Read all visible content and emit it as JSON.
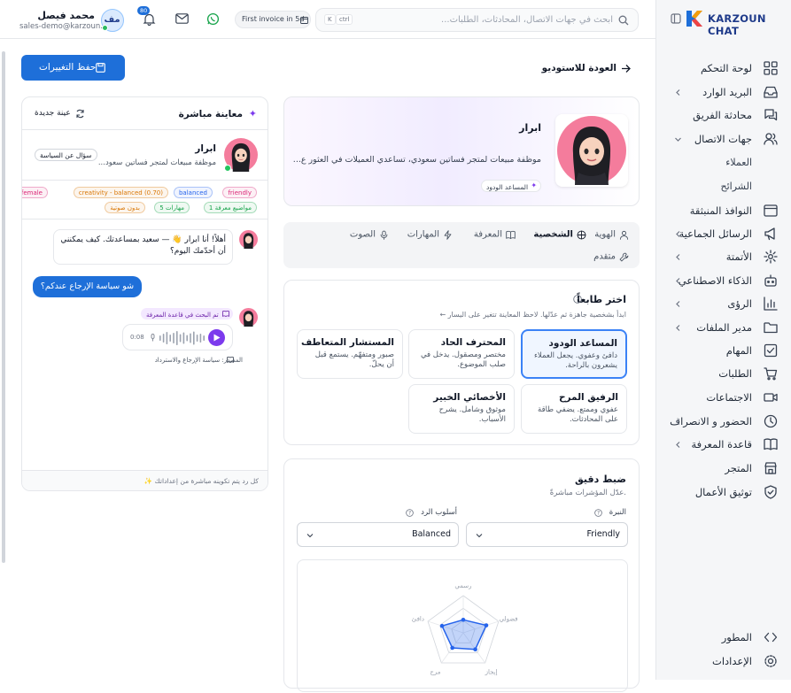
{
  "sidebar": {
    "brand": "KARZOUN CHAT",
    "items": [
      {
        "label": "لوحة التحكم",
        "icon": "dashboard-icon"
      },
      {
        "label": "البريد الوارد",
        "icon": "inbox-icon"
      },
      {
        "label": "محادثة الفريق",
        "icon": "team-chat-icon"
      },
      {
        "label": "جهات الاتصال",
        "icon": "contacts-icon"
      },
      {
        "label": "العملاء",
        "icon": ""
      },
      {
        "label": "الشرائح",
        "icon": ""
      },
      {
        "label": "النوافذ المنبثقة",
        "icon": "popup-icon"
      },
      {
        "label": "الرسائل الجماعية",
        "icon": "megaphone-icon"
      },
      {
        "label": "الأتمتة",
        "icon": "automation-icon"
      },
      {
        "label": "الذكاء الاصطناعي",
        "icon": "ai-bot-icon"
      },
      {
        "label": "الرؤى",
        "icon": "insights-icon"
      },
      {
        "label": "مدير الملفات",
        "icon": "folder-icon"
      },
      {
        "label": "المهام",
        "icon": "tasks-icon"
      },
      {
        "label": "الطلبات",
        "icon": "cart-icon"
      },
      {
        "label": "الاجتماعات",
        "icon": "video-icon"
      },
      {
        "label": "الحضور و الانصراف",
        "icon": "clock-icon"
      },
      {
        "label": "قاعدة المعرفة",
        "icon": "book-icon"
      },
      {
        "label": "المتجر",
        "icon": "store-icon"
      },
      {
        "label": "توثيق الأعمال",
        "icon": "shield-check-icon"
      }
    ],
    "developer": "المطور",
    "settings": "الإعدادات"
  },
  "topbar": {
    "search_placeholder": "ابحث في جهات الاتصال، المحادثات، الطلبات...",
    "shortcut_k": "K",
    "shortcut_ctrl": "ctrl",
    "invoice": "First invoice in 5d",
    "notifications_count": "80",
    "user_name": "محمد فيصل",
    "user_email": "sales-demo@karzoun...",
    "user_initials": "مف"
  },
  "main": {
    "back_label": "العودة للاستوديو",
    "save_label": "حفظ التغييرات",
    "agent": {
      "name": "ابرار",
      "description": "موظفة مبيعات لمتجر فساتين سعودي، تساعدي العميلات في العثور ع...",
      "badge": "المساعد الودود"
    },
    "tabs": [
      "الهوية",
      "الشخصية",
      "المعرفة",
      "المهارات",
      "الصوت",
      "متقدم"
    ],
    "active_tab": "الشخصية",
    "personality": {
      "title": "اختر طابعاً",
      "subtitle": "ابدأ بشخصية جاهزة ثم عدّلها. لاحظ المعاينة تتغير على اليسار ←",
      "cards": [
        {
          "title": "المساعد الودود",
          "desc": "دافئ وعفوي. يجعل العملاء يشعرون بالراحة."
        },
        {
          "title": "المحترف الحاد",
          "desc": "مختصر ومصقول. يدخل في صلب الموضوع."
        },
        {
          "title": "المستشار المتعاطف",
          "desc": "صبور ومتفهّم. يستمع قبل أن يحلّ."
        },
        {
          "title": "الرفيق المرح",
          "desc": "عفوي وممتع. يضفي طاقة على المحادثات."
        },
        {
          "title": "الأخصائي الخبير",
          "desc": "موثوق وشامل. يشرح الأسباب."
        }
      ]
    },
    "fine_tune": {
      "title": "ضبط دقيق",
      "subtitle": "عدّل المؤشرات مباشرةً.",
      "tone_label": "النبرة",
      "tone_value": "Friendly",
      "style_label": "أسلوب الرد",
      "style_value": "Balanced"
    }
  },
  "chart_data": {
    "type": "radar",
    "axes": [
      "رسمي",
      "فضولي",
      "إيجاز",
      "مرح",
      "دافئ"
    ],
    "values": [
      0.35,
      0.65,
      0.55,
      0.5,
      0.6
    ],
    "range": [
      0,
      1
    ],
    "color": "#2563eb"
  },
  "preview": {
    "title": "معاينة مباشرة",
    "new_sample": "عينة جديدة",
    "agent_name": "ابرار",
    "agent_desc": "موظفة مبيعات لمتجر فساتين سعود...",
    "sample_question": "سؤال عن السياسة",
    "tags_row1": [
      {
        "text": "friendly",
        "color": "#db2777"
      },
      {
        "text": "balanced",
        "color": "#2563eb"
      },
      {
        "text": "creativity - balanced (0.70)",
        "color": "#d97706"
      },
      {
        "text": "female",
        "color": "#db2777"
      }
    ],
    "tags_row2": [
      {
        "text": "1 مواضيع معرفة",
        "color": "#16a34a"
      },
      {
        "text": "5 مهارات",
        "color": "#16a34a"
      },
      {
        "text": "بدون صوتية",
        "color": "#d97706"
      }
    ],
    "greeting": "أهلاً! أنا ابرار 👋 — سعيد بمساعدتك. كيف يمكنني أن أحدّمك اليوم؟",
    "user_message": "شو سياسة الإرجاع عندكم؟",
    "kb_badge": "تم البحث في قاعدة المعرفة",
    "audio_time": "0:08",
    "source": "المصدر: سياسة الإرجاع والاسترداد",
    "footer": "كل رد يتم تكوينه مباشرة من إعداداتك ✨"
  }
}
